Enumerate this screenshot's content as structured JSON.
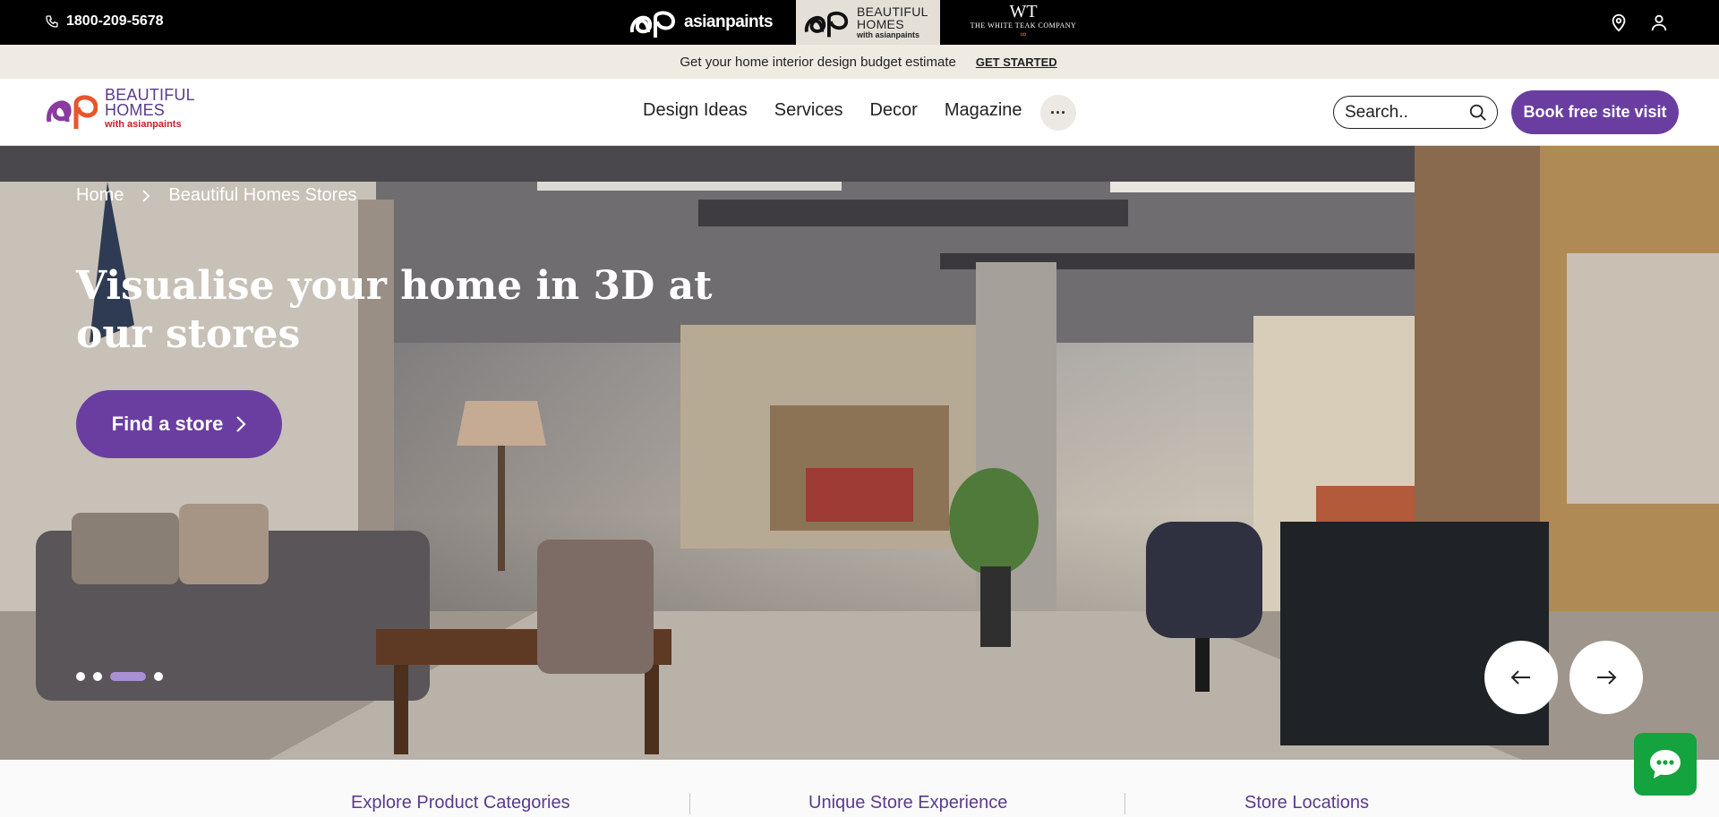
{
  "topbar": {
    "phone": "1800-209-5678",
    "brands": {
      "asianpaints": "asianpaints",
      "bh_line1": "BEAUTIFUL",
      "bh_line2": "HOMES",
      "bh_line3": "with asianpaints",
      "wtc_monogram": "WT",
      "wtc_name": "THE WHITE TEAK COMPANY"
    },
    "icons": [
      "location-icon",
      "user-icon"
    ]
  },
  "promo": {
    "text": "Get your home interior design budget estimate",
    "cta": "GET STARTED"
  },
  "nav": {
    "logo": {
      "line1": "BEAUTIFUL",
      "line2": "HOMES",
      "line3": "with asianpaints"
    },
    "menu": [
      "Design Ideas",
      "Services",
      "Decor",
      "Magazine"
    ],
    "more": "···",
    "search_placeholder": "Search..",
    "book_label": "Book free site visit"
  },
  "hero": {
    "breadcrumb": [
      "Home",
      "Beautiful Homes Stores"
    ],
    "title": "Visualise your home in 3D at our stores",
    "cta": "Find a store",
    "slide_count": 4,
    "active_slide": 3
  },
  "tabs": [
    "Explore Product Categories",
    "Unique Store Experience",
    "Store Locations"
  ],
  "colors": {
    "brand_purple": "#6a3ea1",
    "promo_bg": "#efebe3",
    "chat_green": "#14a33e"
  }
}
